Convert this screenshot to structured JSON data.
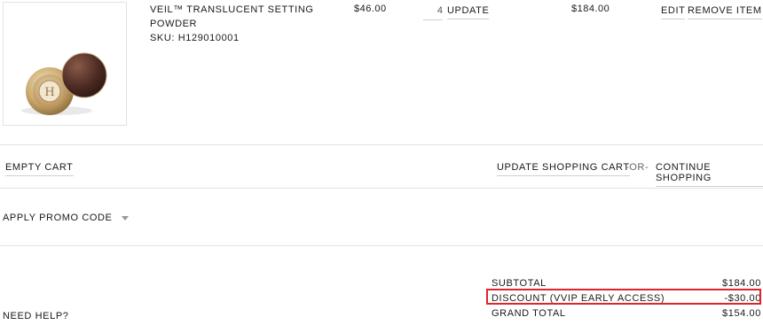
{
  "item": {
    "name": "VEIL™ TRANSLUCENT SETTING POWDER",
    "sku": "SKU: H129010001",
    "price": "$46.00",
    "quantity": "4",
    "update_label": "UPDATE",
    "line_total": "$184.00",
    "edit_label": "EDIT",
    "remove_label": "REMOVE ITEM"
  },
  "cart_actions": {
    "empty_label": "EMPTY CART",
    "update_cart_label": "UPDATE SHOPPING CART",
    "or_label": "-OR-",
    "continue_label": "CONTINUE SHOPPING"
  },
  "promo": {
    "label": "APPLY PROMO CODE"
  },
  "totals": {
    "subtotal_label": "SUBTOTAL",
    "subtotal_value": "$184.00",
    "discount_label": "DISCOUNT (VVIP EARLY ACCESS)",
    "discount_value": "-$30.00",
    "grand_label": "GRAND TOTAL",
    "grand_value": "$154.00"
  },
  "help": {
    "label": "NEED HELP?"
  },
  "colors": {
    "highlight": "#e0242a",
    "rule": "#e3e3e3"
  }
}
